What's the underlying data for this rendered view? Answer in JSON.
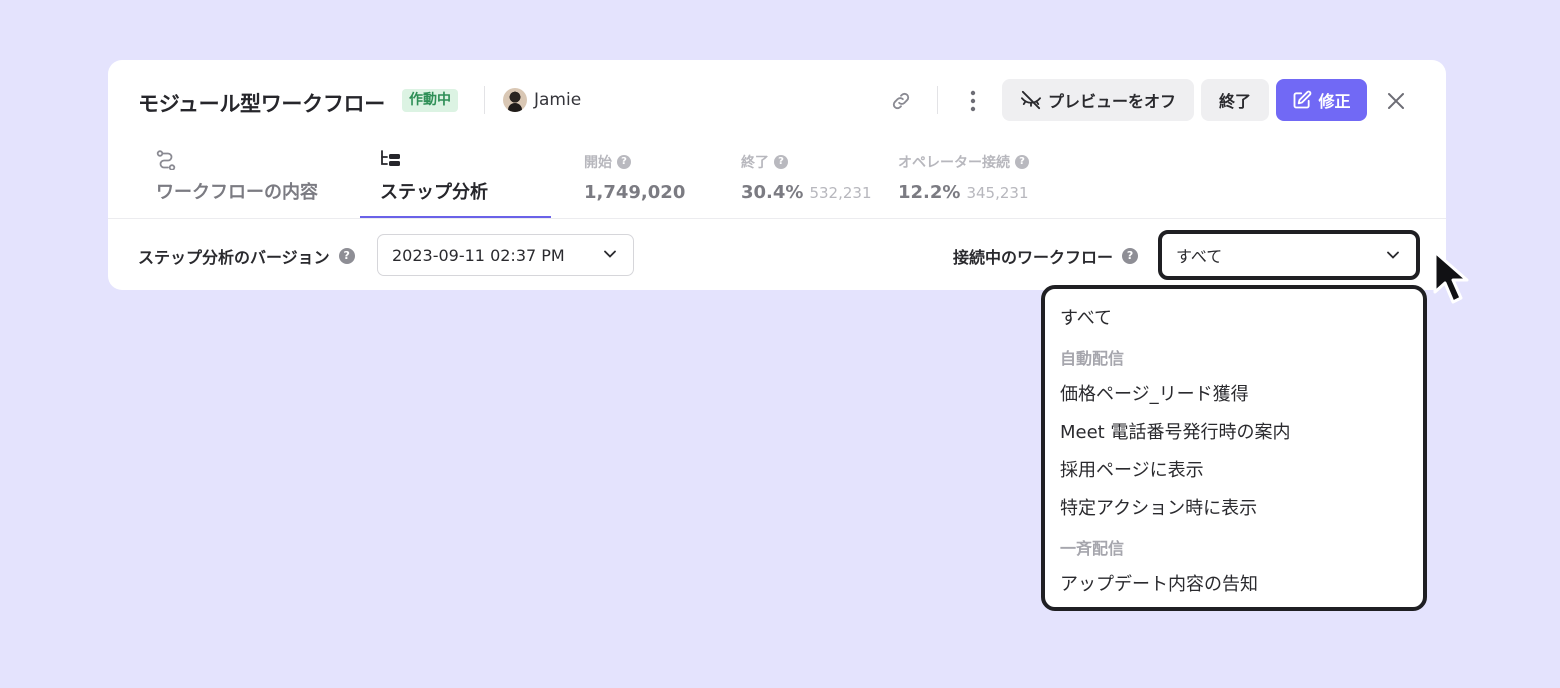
{
  "header": {
    "title": "モジュール型ワークフロー",
    "status": "作動中",
    "owner": "Jamie",
    "buttons": {
      "preview_off": "プレビューをオフ",
      "end": "終了",
      "edit": "修正"
    }
  },
  "tabs": [
    {
      "label": "ワークフローの内容",
      "icon": "flow-icon",
      "active": false
    },
    {
      "label": "ステップ分析",
      "icon": "steps-icon",
      "active": true
    }
  ],
  "stats": [
    {
      "label": "開始",
      "value": "1,749,020",
      "sub": ""
    },
    {
      "label": "終了",
      "value": "30.4%",
      "sub": "532,231"
    },
    {
      "label": "オペレーター接続",
      "value": "12.2%",
      "sub": "345,231"
    }
  ],
  "filters": {
    "version_label": "ステップ分析のバージョン",
    "version_value": "2023-09-11 02:37 PM",
    "connected_label": "接続中のワークフロー",
    "connected_value": "すべて"
  },
  "dropdown": {
    "all": "すべて",
    "group_auto": "自動配信",
    "auto_items": [
      "価格ページ_リード獲得",
      "Meet 電話番号発行時の案内",
      "採用ページに表示",
      "特定アクション時に表示"
    ],
    "group_broadcast": "一斉配信",
    "broadcast_items": [
      "アップデート内容の告知"
    ]
  },
  "colors": {
    "background": "#e4e3fd",
    "accent": "#7169f5",
    "status_bg": "#dcf3e3",
    "status_text": "#2e8f56"
  }
}
